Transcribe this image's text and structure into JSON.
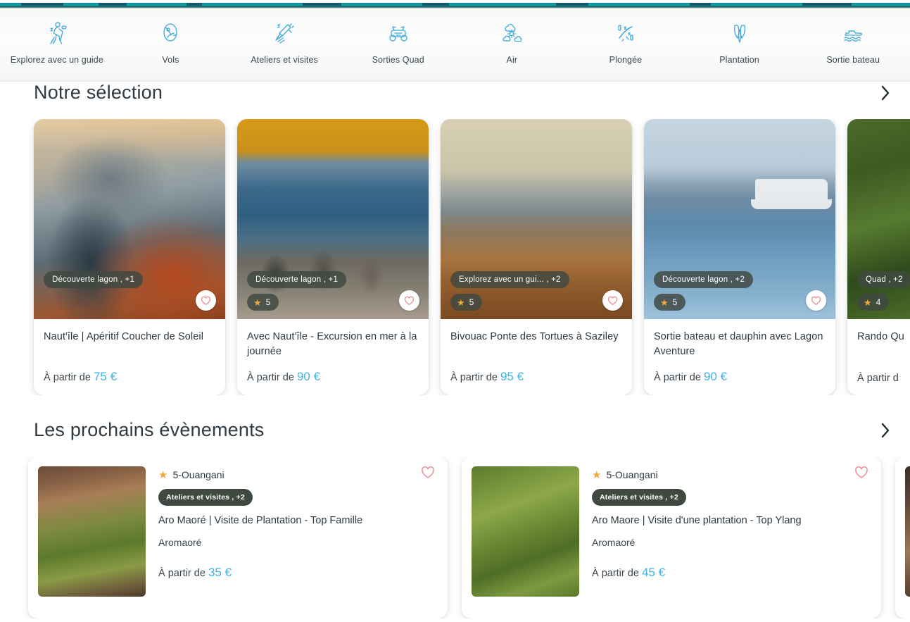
{
  "top_bar": {
    "accent_color": "#11a3a8"
  },
  "category_nav": {
    "items": [
      {
        "label": "Explorez avec un guide",
        "icon": "hiker-icon"
      },
      {
        "label": "Vols",
        "icon": "paraglider-icon"
      },
      {
        "label": "Ateliers et visites",
        "icon": "workshop-icon"
      },
      {
        "label": "Sorties Quad",
        "icon": "quad-bike-icon"
      },
      {
        "label": "Air",
        "icon": "clouds-sun-icon"
      },
      {
        "label": "Plongée",
        "icon": "diving-icon"
      },
      {
        "label": "Plantation",
        "icon": "plant-leaves-icon"
      },
      {
        "label": "Sortie bateau",
        "icon": "boat-icon"
      }
    ]
  },
  "selection": {
    "title": "Notre sélection",
    "next_label": "›",
    "price_prefix": "À partir de",
    "cards": [
      {
        "chip": "Découverte lagon , +1",
        "rating": null,
        "title": "Naut'île | Apéritif Coucher de Soleil",
        "price": "75 €",
        "image": "sunset-boat-aperitif"
      },
      {
        "chip": "Découverte lagon , +1",
        "rating": "5",
        "title": "Avec Naut'île - Excursion en mer à la journée",
        "price": "90 €",
        "image": "boat-passengers-sea"
      },
      {
        "chip": "Explorez avec un gui... , +2",
        "rating": "5",
        "title": "Bivouac Ponte des Tortues à Saziley",
        "price": "95 €",
        "image": "beach-turtle-tracks"
      },
      {
        "chip": "Découverte lagon , +2",
        "rating": "5",
        "title": "Sortie bateau et dauphin avec Lagon Aventure",
        "price": "90 €",
        "image": "dolphin-boat-lagoon"
      },
      {
        "chip": "Quad , +2",
        "rating": "4",
        "title": "Rando Qu",
        "price": "À partir d",
        "image": "jungle-greenery"
      }
    ]
  },
  "events": {
    "title": "Les prochains évènements",
    "next_label": "›",
    "price_prefix": "À partir de",
    "cards": [
      {
        "location": "5-Ouangani",
        "chip": "Ateliers et visites , +2",
        "title": "Aro Maoré | Visite de Plantation - Top Famille",
        "organizer": "Aromaoré",
        "price": "35 €",
        "image": "weaving-palm-leaves"
      },
      {
        "location": "5-Ouangani",
        "chip": "Ateliers et visites , +2",
        "title": "Aro Maore | Visite d'une plantation - Top Ylang",
        "organizer": "Aromaoré",
        "price": "45 €",
        "image": "people-circle-grass"
      },
      {
        "location": "",
        "chip": "",
        "title": "",
        "organizer": "",
        "price": "",
        "image": "person-portrait"
      }
    ]
  },
  "colors": {
    "accent_teal": "#11a3a8",
    "price_blue": "#3fb3e3",
    "icon_blue": "#3aa8d8",
    "chip_dark": "#3f4942",
    "star_gold": "#f2a93b",
    "heart_pink": "#e98b93",
    "text_dark": "#2d3942"
  }
}
